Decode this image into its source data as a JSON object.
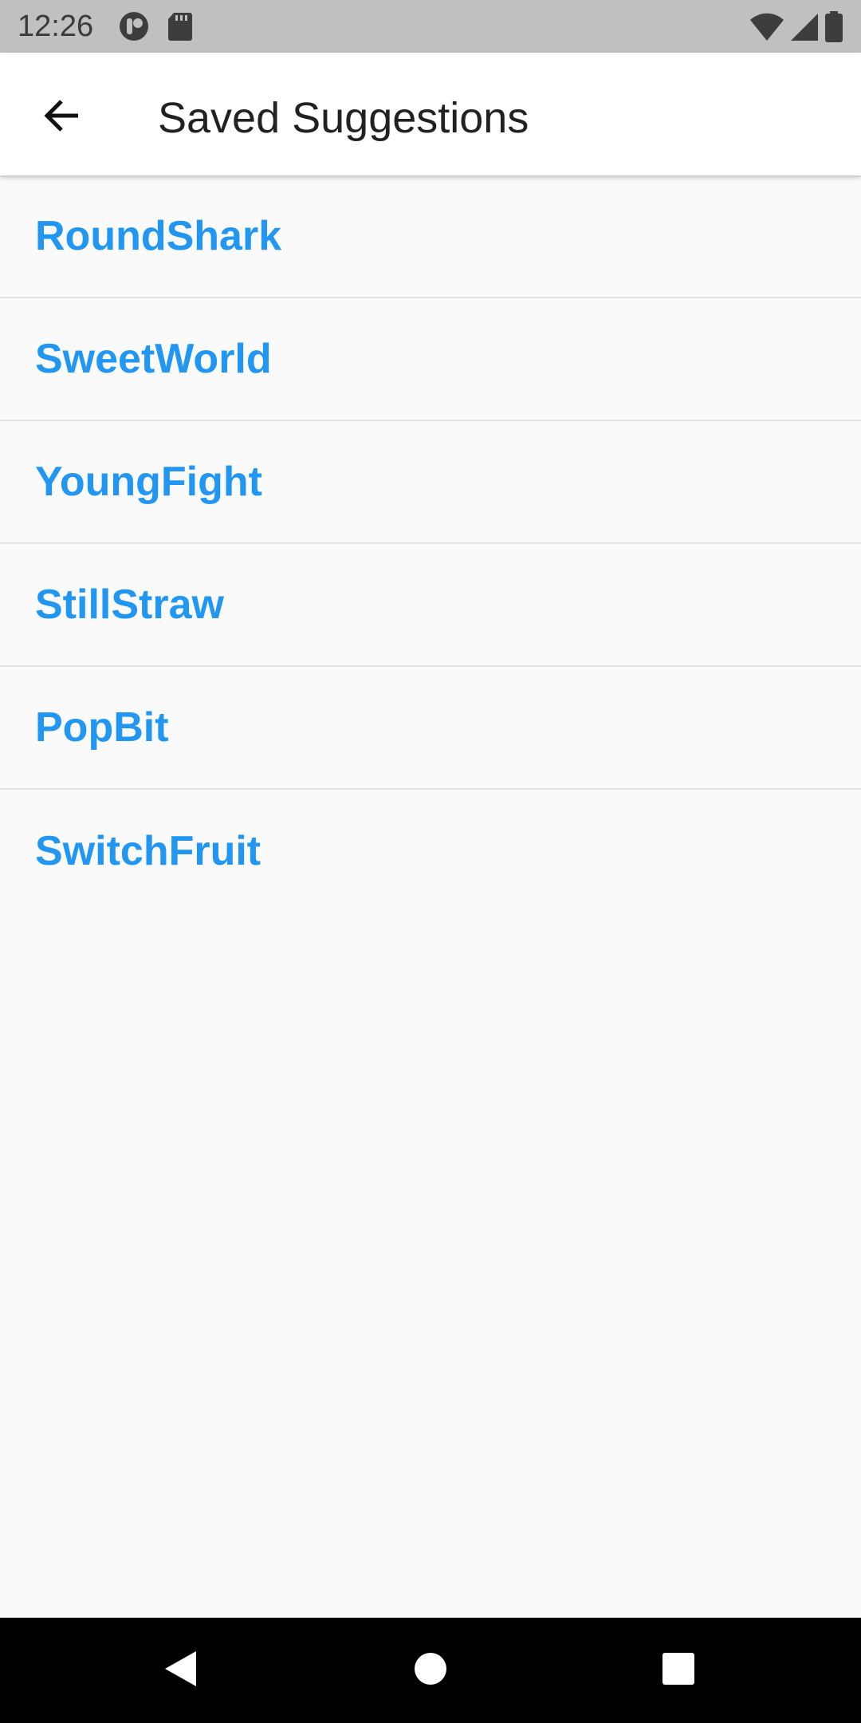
{
  "status_bar": {
    "time": "12:26",
    "left_icons": [
      "notification-app-icon",
      "sd-card-icon"
    ],
    "right_icons": [
      "wifi-icon",
      "cellular-signal-icon",
      "battery-icon"
    ]
  },
  "app_bar": {
    "title": "Saved Suggestions",
    "back_icon": "arrow-back-icon"
  },
  "saved_list": {
    "items": [
      {
        "label": "RoundShark"
      },
      {
        "label": "SweetWorld"
      },
      {
        "label": "YoungFight"
      },
      {
        "label": "StillStraw"
      },
      {
        "label": "PopBit"
      },
      {
        "label": "SwitchFruit"
      }
    ]
  },
  "nav_bar": {
    "buttons": [
      "nav-back-icon",
      "nav-home-icon",
      "nav-recents-icon"
    ]
  },
  "colors": {
    "status_bar_bg": "#c0c0c0",
    "app_bar_bg": "#ffffff",
    "list_text": "#2196f3",
    "page_bg": "#fafafa",
    "nav_bar_bg": "#000000"
  }
}
